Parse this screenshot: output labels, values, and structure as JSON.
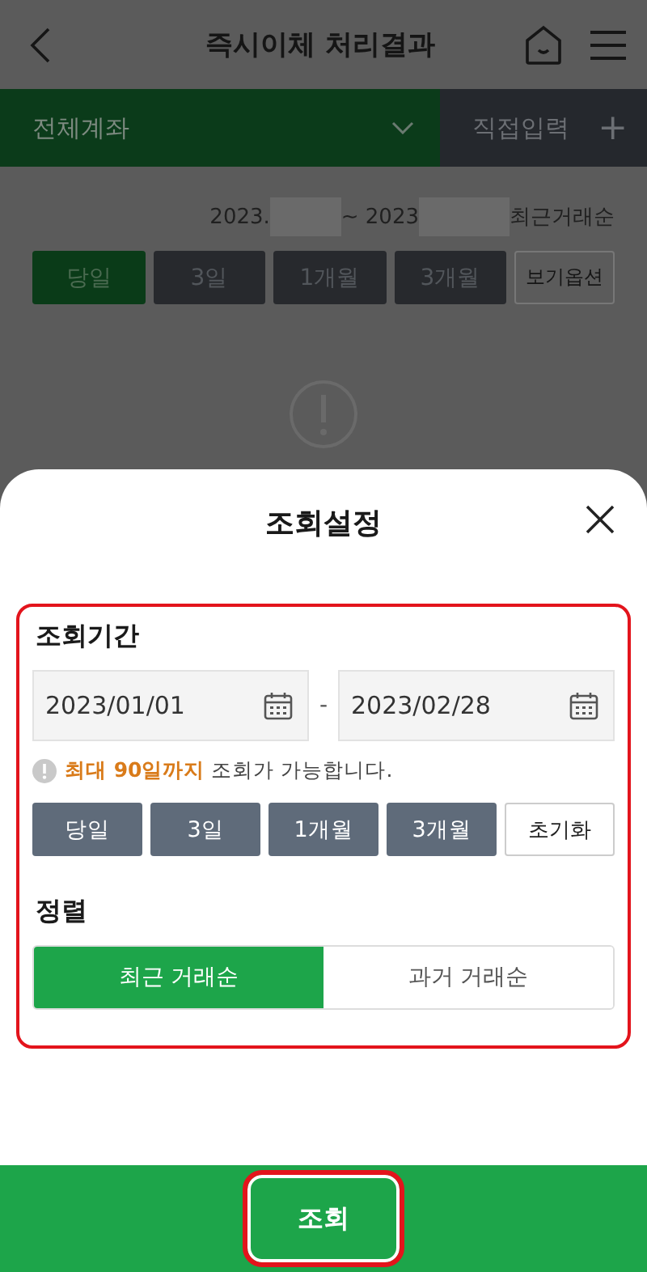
{
  "header": {
    "title": "즉시이체 처리결과"
  },
  "account_bar": {
    "account": "전체계좌",
    "direct_input": "직접입력",
    "plus": "+"
  },
  "range_summary": {
    "start": "2023.",
    "end": "~ 2023",
    "order": "최근거래순"
  },
  "period_buttons": [
    {
      "label": "당일",
      "selected": true
    },
    {
      "label": "3일",
      "selected": false
    },
    {
      "label": "1개월",
      "selected": false
    },
    {
      "label": "3개월",
      "selected": false
    }
  ],
  "view_options": "보기옵션",
  "sheet": {
    "title": "조회설정",
    "period_label": "조회기간",
    "date_from": "2023/01/01",
    "separator": "-",
    "date_to": "2023/02/28",
    "notice": "**최대 90일까지** 조회가 가능합니다.",
    "period_buttons": [
      {
        "label": "당일",
        "selected": false
      },
      {
        "label": "3일",
        "selected": false
      },
      {
        "label": "1개월",
        "selected": false
      },
      {
        "label": "3개월",
        "selected": false
      }
    ],
    "reset": "초기화",
    "sort_label": "정렬",
    "sort_options": [
      {
        "label": "최근 거래순",
        "selected": true
      },
      {
        "label": "과거 거래순",
        "selected": false
      }
    ],
    "submit": "조회"
  }
}
